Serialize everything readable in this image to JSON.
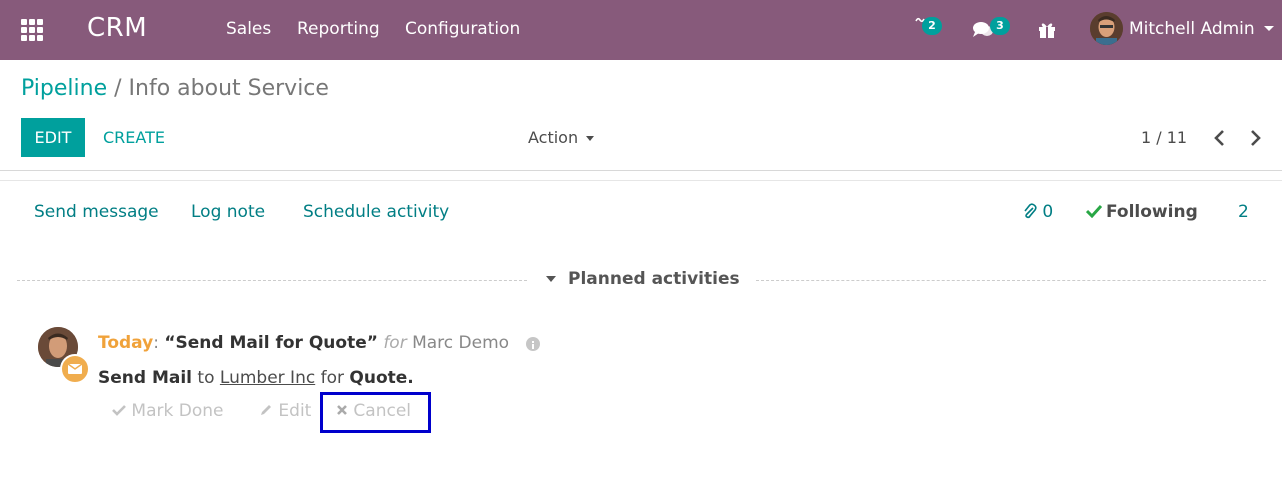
{
  "navbar": {
    "app_name": "CRM",
    "menu": [
      "Sales",
      "Reporting",
      "Configuration"
    ],
    "activity_count": "2",
    "message_count": "3",
    "user_name": "Mitchell Admin",
    "bg_color": "#875a7b"
  },
  "control_panel": {
    "breadcrumb_parent": "Pipeline",
    "breadcrumb_separator": "/",
    "breadcrumb_current": "Info about Service",
    "edit_label": "EDIT",
    "create_label": "CREATE",
    "action_label": "Action",
    "pager": "1 / 11"
  },
  "chatter": {
    "send_message": "Send message",
    "log_note": "Log note",
    "schedule_activity": "Schedule activity",
    "attachment_count": "0",
    "following_label": "Following",
    "follower_count": "2",
    "planned_title": "Planned activities",
    "activity": {
      "when": "Today",
      "colon": ":",
      "summary": "“Send Mail for Quote”",
      "for_label": "for",
      "assignee": "Marc Demo",
      "type": "Send Mail",
      "to_label": "to",
      "partner": "Lumber Inc",
      "for_label2": "for",
      "record": "Quote.",
      "mark_done": "Mark Done",
      "edit": "Edit",
      "cancel": "Cancel"
    }
  },
  "colors": {
    "accent": "#00a09d",
    "today": "#f0a23a",
    "highlight_box": "#0000cc"
  },
  "icons": [
    "apps-grid-icon",
    "activity-icon",
    "chat-icon",
    "gift-icon",
    "chevron-left-icon",
    "chevron-right-icon",
    "paperclip-icon",
    "check-icon",
    "envelope-icon",
    "info-icon",
    "pencil-icon",
    "times-icon"
  ]
}
